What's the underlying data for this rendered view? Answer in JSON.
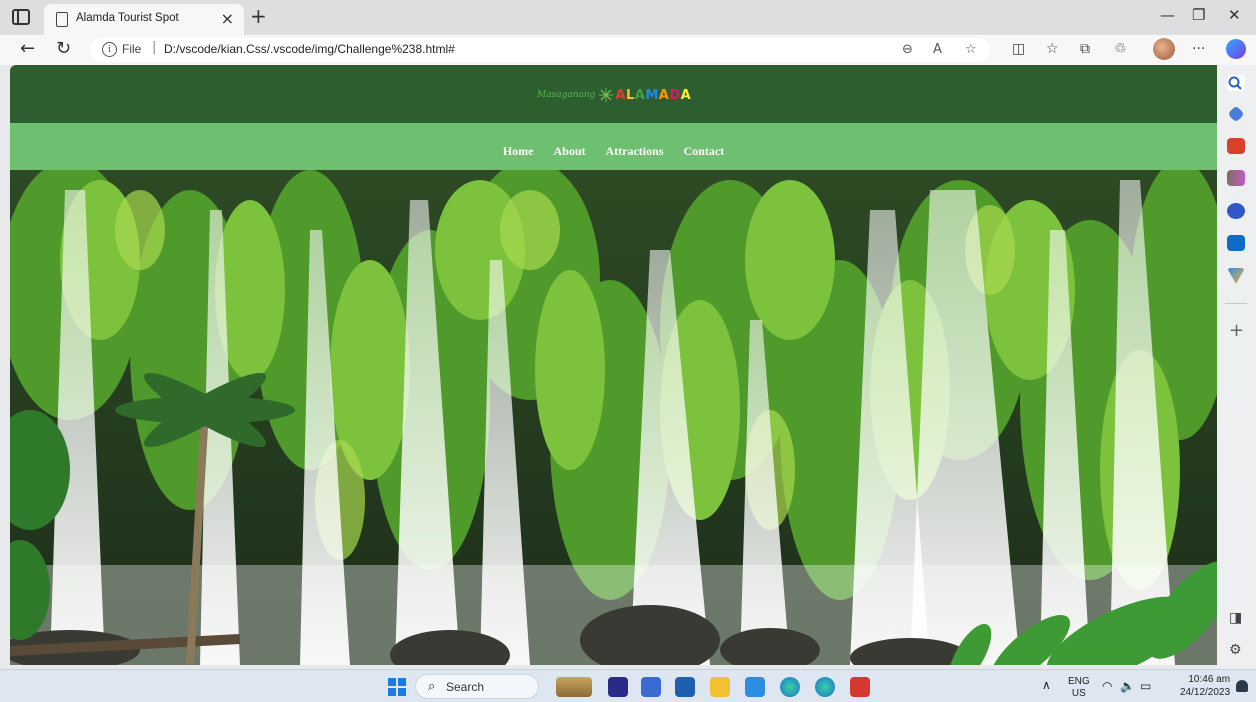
{
  "browser": {
    "tab_title": "Alamda Tourist Spot",
    "address_prefix": "File",
    "url": "D:/vscode/kian.Css/.vscode/img/Challenge%238.html#"
  },
  "site": {
    "logo_script": "Masaganang",
    "logo_word": "ALAMADA",
    "logo_letter_colors": [
      "#e53935",
      "#fbc02d",
      "#43a047",
      "#1e88e5",
      "#ff9800",
      "#d81b60",
      "#ffeb3b"
    ],
    "nav": [
      "Home",
      "About",
      "Attractions",
      "Contact"
    ],
    "header_color": "#2d5e2f",
    "nav_color": "#6ebf6f"
  },
  "hero": {
    "subject": "waterfall-over-mossy-cliff"
  },
  "taskbar": {
    "search_label": "Search",
    "lang_line1": "ENG",
    "lang_line2": "US",
    "time": "10:46 am",
    "date": "24/12/2023"
  }
}
